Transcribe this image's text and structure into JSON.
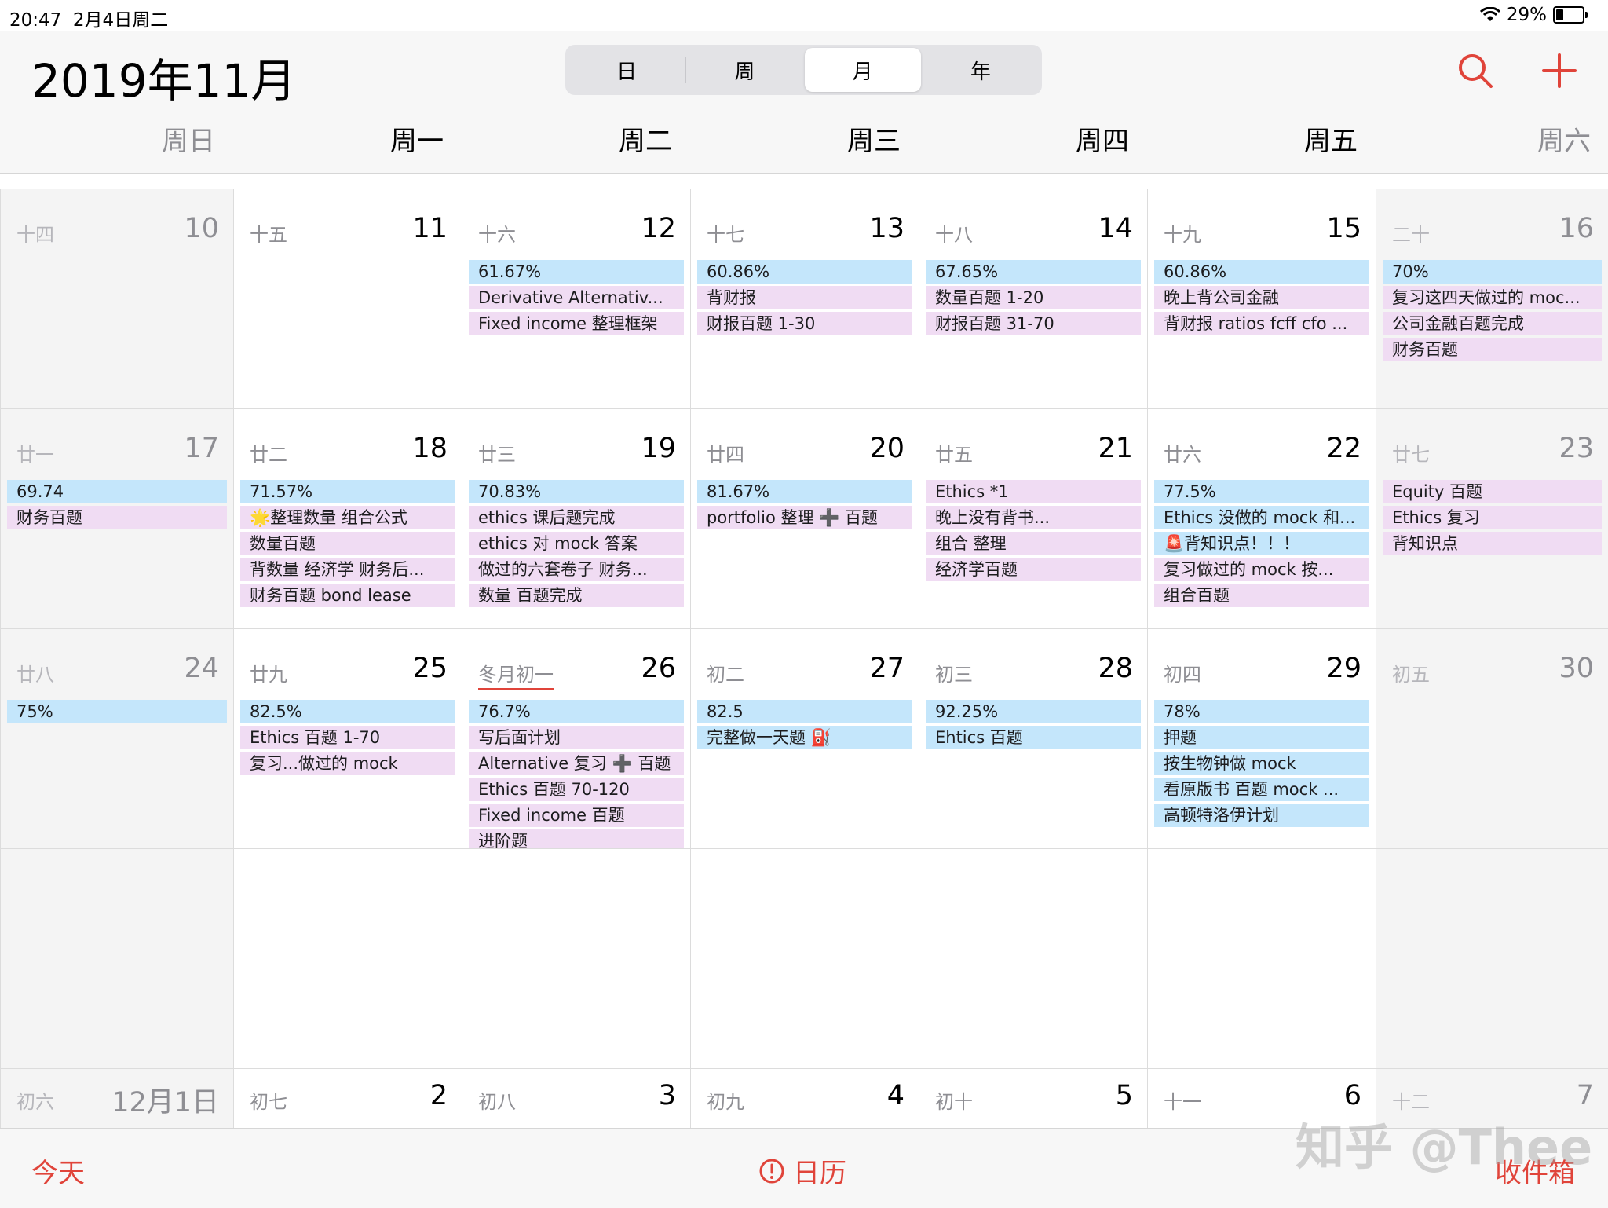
{
  "status": {
    "time": "20:47",
    "date": "2月4日周二",
    "battery": "29%",
    "battery_level": 0.29
  },
  "header": {
    "title": "2019年11月",
    "segments": [
      "日",
      "周",
      "月",
      "年"
    ],
    "active_segment": 2,
    "accent": "#e0443a"
  },
  "weekdays": [
    "周日",
    "周一",
    "周二",
    "周三",
    "周四",
    "周五",
    "周六"
  ],
  "weeks": [
    {
      "days": [
        {
          "lunar": "十四",
          "num": "10",
          "events": []
        },
        {
          "lunar": "十五",
          "num": "11",
          "events": []
        },
        {
          "lunar": "十六",
          "num": "12",
          "events": [
            {
              "text": "61.67%",
              "color": "blue"
            },
            {
              "text": "Derivative Alternativ...",
              "color": "pink"
            },
            {
              "text": "Fixed income 整理框架",
              "color": "pink"
            }
          ]
        },
        {
          "lunar": "十七",
          "num": "13",
          "events": [
            {
              "text": "60.86%",
              "color": "blue"
            },
            {
              "text": "背财报",
              "color": "pink"
            },
            {
              "text": "财报百题 1-30",
              "color": "pink"
            }
          ]
        },
        {
          "lunar": "十八",
          "num": "14",
          "events": [
            {
              "text": "67.65%",
              "color": "blue"
            },
            {
              "text": "数量百题 1-20",
              "color": "pink"
            },
            {
              "text": "财报百题 31-70",
              "color": "pink"
            }
          ]
        },
        {
          "lunar": "十九",
          "num": "15",
          "events": [
            {
              "text": "60.86%",
              "color": "blue"
            },
            {
              "text": "晚上背公司金融",
              "color": "pink"
            },
            {
              "text": "背财报 ratios fcff cfo ...",
              "color": "pink"
            }
          ]
        },
        {
          "lunar": "二十",
          "num": "16",
          "events": [
            {
              "text": "70%",
              "color": "blue"
            },
            {
              "text": "复习这四天做过的 moc...",
              "color": "pink"
            },
            {
              "text": "公司金融百题完成",
              "color": "pink"
            },
            {
              "text": "财务百题",
              "color": "pink"
            }
          ]
        }
      ]
    },
    {
      "days": [
        {
          "lunar": "廿一",
          "num": "17",
          "events": [
            {
              "text": "69.74",
              "color": "blue"
            },
            {
              "text": "财务百题",
              "color": "pink"
            }
          ]
        },
        {
          "lunar": "廿二",
          "num": "18",
          "events": [
            {
              "text": "71.57%",
              "color": "blue"
            },
            {
              "text": "🌟整理数量 组合公式",
              "color": "pink"
            },
            {
              "text": "数量百题",
              "color": "pink"
            },
            {
              "text": "背数量 经济学 财务后...",
              "color": "pink"
            },
            {
              "text": "财务百题 bond lease",
              "color": "pink"
            }
          ]
        },
        {
          "lunar": "廿三",
          "num": "19",
          "events": [
            {
              "text": "70.83%",
              "color": "blue"
            },
            {
              "text": "ethics 课后题完成",
              "color": "pink"
            },
            {
              "text": "ethics 对 mock 答案",
              "color": "pink"
            },
            {
              "text": "做过的六套卷子 财务...",
              "color": "pink"
            },
            {
              "text": "数量 百题完成",
              "color": "pink"
            }
          ]
        },
        {
          "lunar": "廿四",
          "num": "20",
          "events": [
            {
              "text": "81.67%",
              "color": "blue"
            },
            {
              "text": "portfolio 整理 ➕ 百题",
              "color": "pink"
            }
          ]
        },
        {
          "lunar": "廿五",
          "num": "21",
          "events": [
            {
              "text": "Ethics *1",
              "color": "pink"
            },
            {
              "text": "晚上没有背书...",
              "color": "pink"
            },
            {
              "text": "组合 整理",
              "color": "pink"
            },
            {
              "text": "经济学百题",
              "color": "pink"
            }
          ]
        },
        {
          "lunar": "廿六",
          "num": "22",
          "events": [
            {
              "text": "77.5%",
              "color": "blue"
            },
            {
              "text": "Ethics 没做的 mock 和...",
              "color": "blue"
            },
            {
              "text": "🚨背知识点！！！",
              "color": "blue"
            },
            {
              "text": "复习做过的 mock 按...",
              "color": "pink"
            },
            {
              "text": "组合百题",
              "color": "pink"
            }
          ]
        },
        {
          "lunar": "廿七",
          "num": "23",
          "events": [
            {
              "text": "Equity 百题",
              "color": "pink"
            },
            {
              "text": "Ethics 复习",
              "color": "pink"
            },
            {
              "text": "背知识点",
              "color": "pink"
            }
          ]
        }
      ]
    },
    {
      "days": [
        {
          "lunar": "廿八",
          "num": "24",
          "events": [
            {
              "text": "75%",
              "color": "blue"
            }
          ]
        },
        {
          "lunar": "廿九",
          "num": "25",
          "events": [
            {
              "text": "82.5%",
              "color": "blue"
            },
            {
              "text": "Ethics 百题 1-70",
              "color": "pink"
            },
            {
              "text": "复习...做过的 mock",
              "color": "pink"
            }
          ]
        },
        {
          "lunar": "冬月初一",
          "num": "26",
          "underline": true,
          "events": [
            {
              "text": "76.7%",
              "color": "blue"
            },
            {
              "text": "写后面计划",
              "color": "pink"
            },
            {
              "text": "Alternative 复习 ➕ 百题",
              "color": "pink"
            },
            {
              "text": "Ethics 百题 70-120",
              "color": "pink"
            },
            {
              "text": "Fixed income 百题",
              "color": "pink"
            },
            {
              "text": "进阶题",
              "color": "pink"
            }
          ]
        },
        {
          "lunar": "初二",
          "num": "27",
          "events": [
            {
              "text": "82.5",
              "color": "blue"
            },
            {
              "text": "完整做一天题 ⛽",
              "color": "blue"
            }
          ]
        },
        {
          "lunar": "初三",
          "num": "28",
          "events": [
            {
              "text": "92.25%",
              "color": "blue"
            },
            {
              "text": "Ehtics 百题",
              "color": "blue"
            }
          ]
        },
        {
          "lunar": "初四",
          "num": "29",
          "events": [
            {
              "text": "78%",
              "color": "blue"
            },
            {
              "text": "押题",
              "color": "blue"
            },
            {
              "text": "按生物钟做 mock",
              "color": "blue"
            },
            {
              "text": "看原版书 百题 mock ...",
              "color": "blue"
            },
            {
              "text": "高顿特洛伊计划",
              "color": "blue"
            }
          ]
        },
        {
          "lunar": "初五",
          "num": "30",
          "events": []
        }
      ]
    },
    {
      "days": [
        {
          "lunar": "",
          "num": "",
          "events": []
        },
        {
          "lunar": "",
          "num": "",
          "events": []
        },
        {
          "lunar": "",
          "num": "",
          "events": []
        },
        {
          "lunar": "",
          "num": "",
          "events": []
        },
        {
          "lunar": "",
          "num": "",
          "events": []
        },
        {
          "lunar": "",
          "num": "",
          "events": []
        },
        {
          "lunar": "",
          "num": "",
          "events": []
        }
      ]
    },
    {
      "days": [
        {
          "lunar": "初六",
          "num": "12月1日",
          "events": []
        },
        {
          "lunar": "初七",
          "num": "2",
          "events": []
        },
        {
          "lunar": "初八",
          "num": "3",
          "events": []
        },
        {
          "lunar": "初九",
          "num": "4",
          "events": []
        },
        {
          "lunar": "初十",
          "num": "5",
          "events": []
        },
        {
          "lunar": "十一",
          "num": "6",
          "events": []
        },
        {
          "lunar": "十二",
          "num": "7",
          "events": []
        }
      ]
    }
  ],
  "footer": {
    "today": "今天",
    "calendars": "日历",
    "inbox": "收件箱"
  },
  "watermark": "知乎 @Thee"
}
